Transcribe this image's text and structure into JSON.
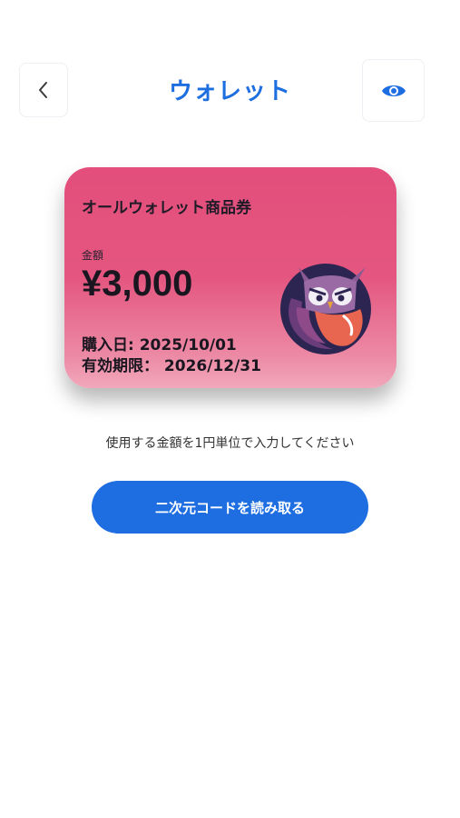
{
  "header": {
    "title": "ウォレット",
    "back_icon": "chevron-left-icon",
    "eye_icon": "eye-icon"
  },
  "card": {
    "name": "オールウォレット商品券",
    "amount_label": "金額",
    "amount": "¥3,000",
    "purchase_date": "購入日: 2025/10/01",
    "expiry_date": "有効期限： 2026/12/31",
    "logo": "owl-logo"
  },
  "instruction": "使用する金額を1円単位で入力してください",
  "scan_button_label": "二次元コードを読み取る",
  "colors": {
    "accent": "#1e6ee2",
    "card": "#e34e7c"
  }
}
